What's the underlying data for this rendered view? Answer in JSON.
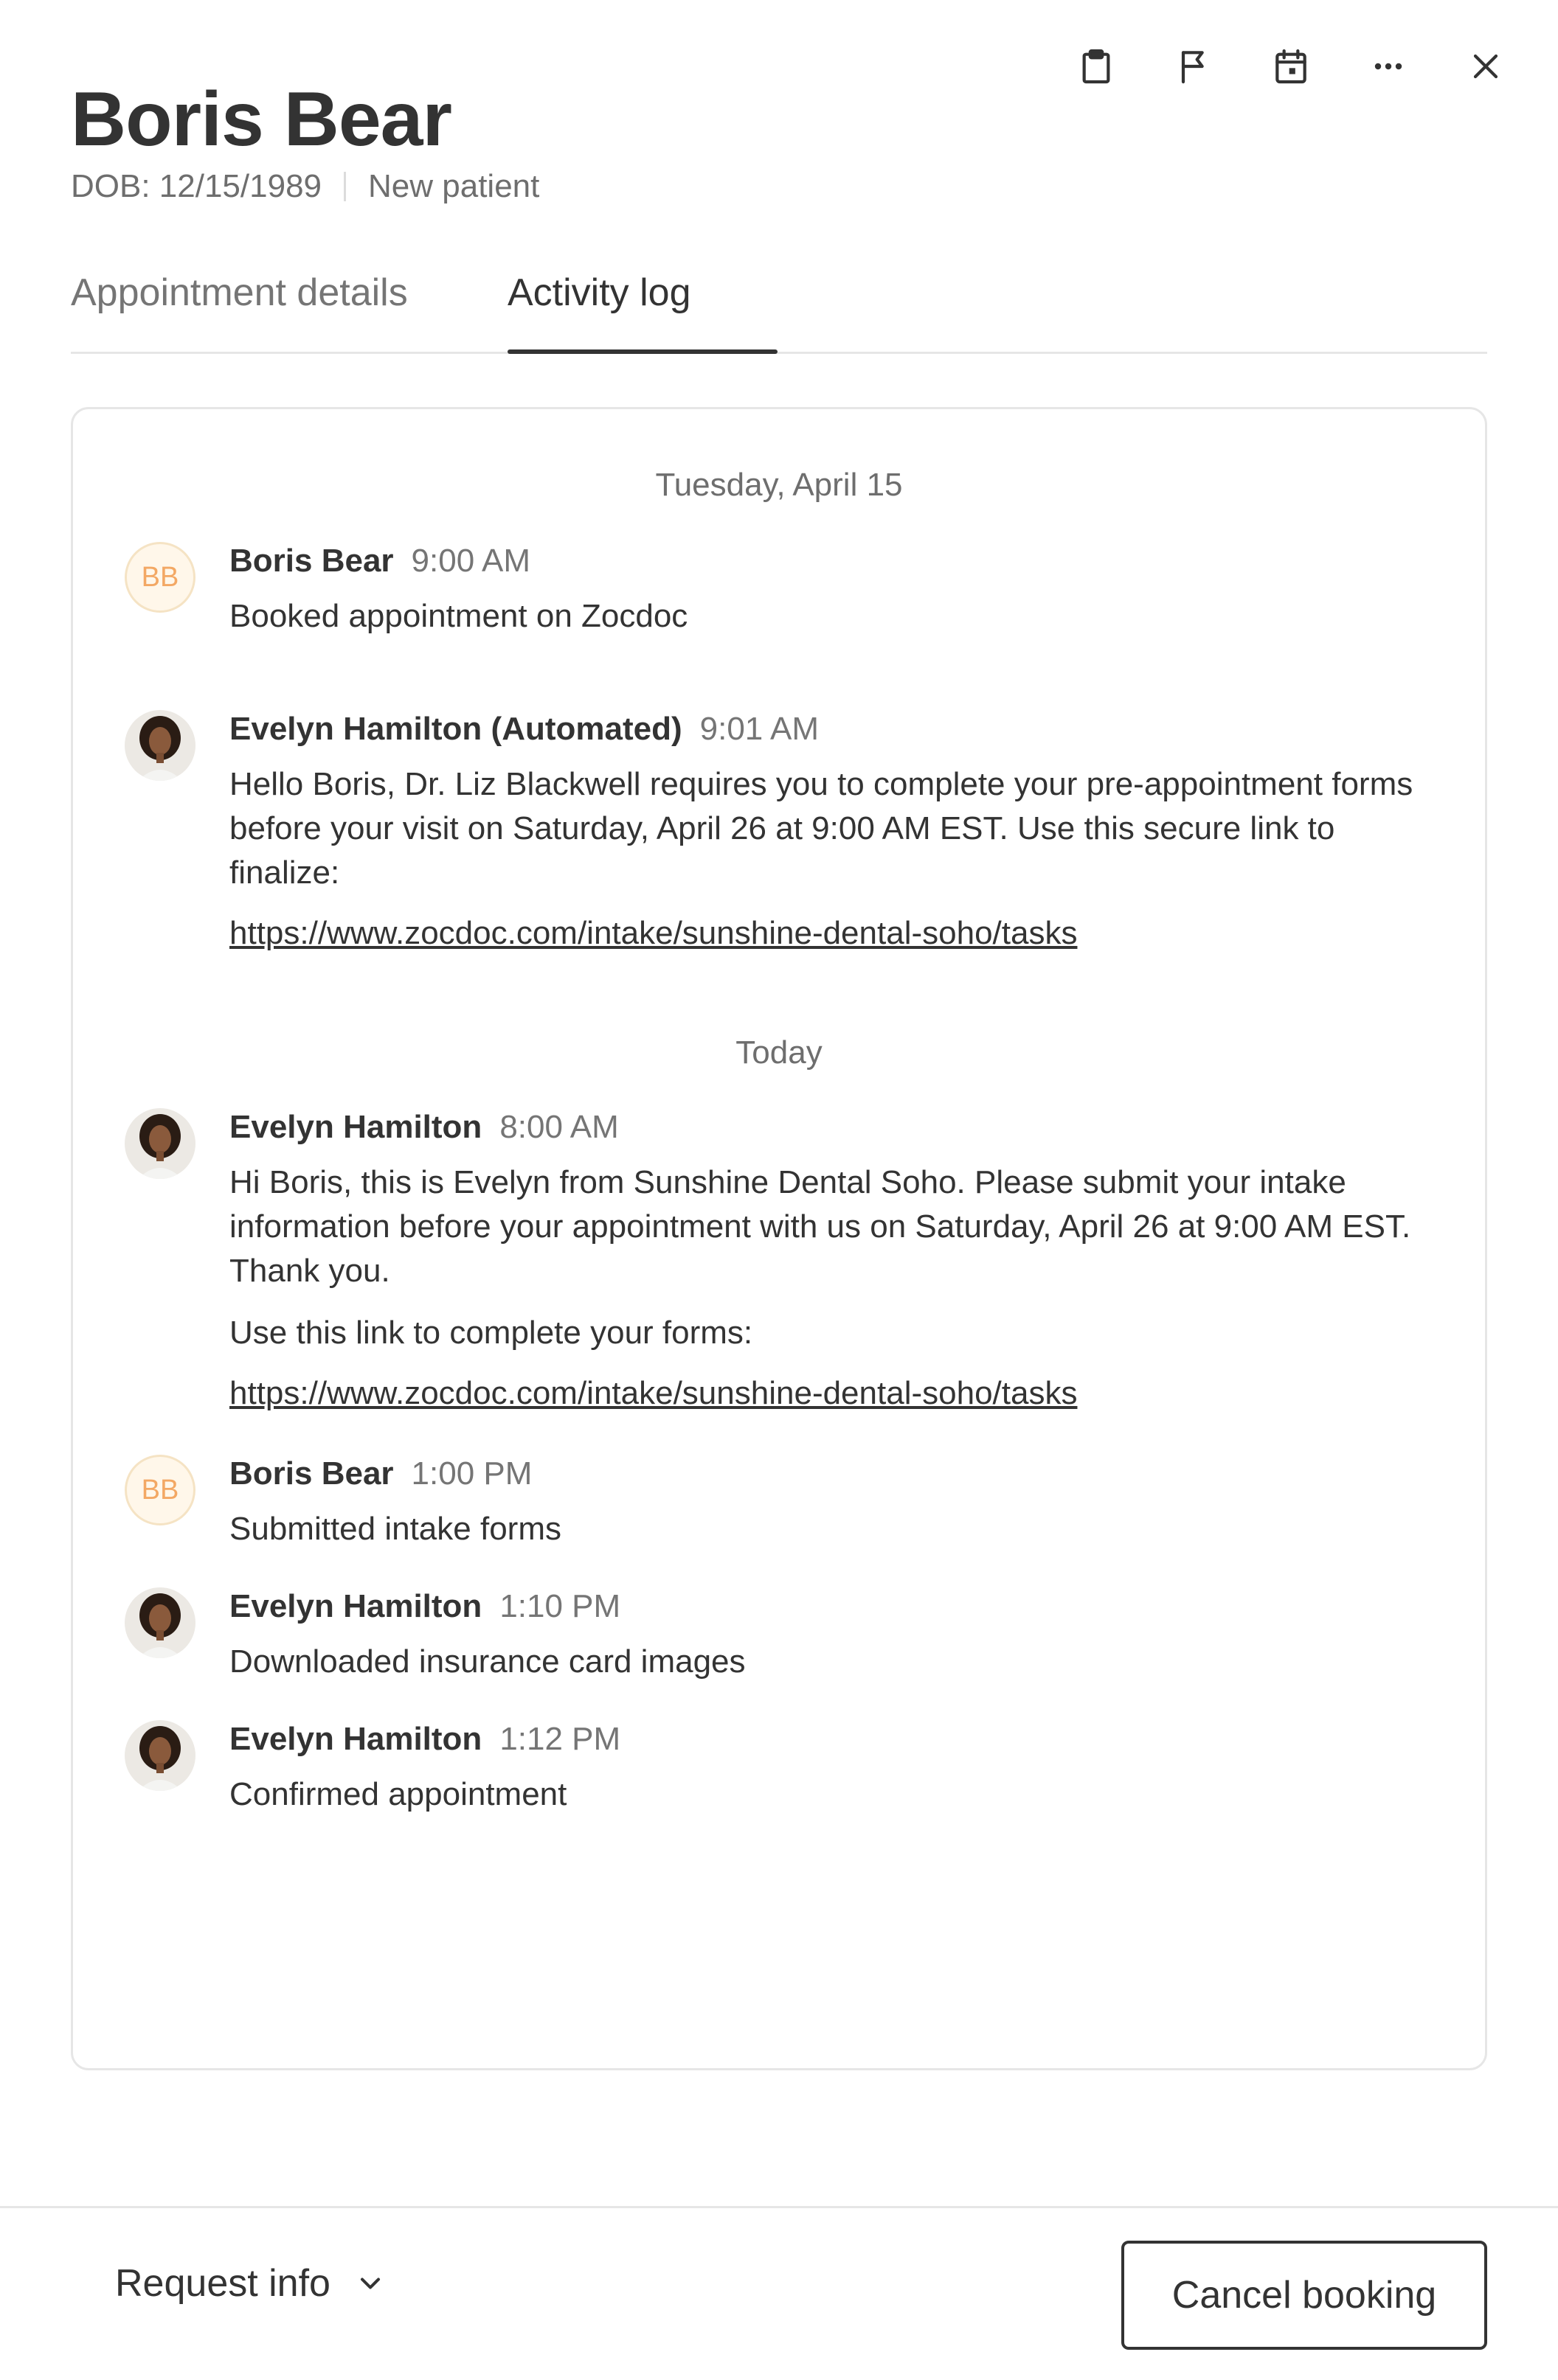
{
  "toolbar": {
    "icons": [
      "clipboard-icon",
      "flag-icon",
      "calendar-icon",
      "more-icon",
      "close-icon"
    ]
  },
  "patient": {
    "name": "Boris Bear",
    "dob": "DOB: 12/15/1989",
    "status": "New patient"
  },
  "tabs": {
    "details": "Appointment details",
    "activity": "Activity log",
    "active": "activity"
  },
  "log": {
    "groups": [
      {
        "date": "Tuesday, April 15",
        "entries": [
          {
            "initials": "BB",
            "author": "Boris Bear",
            "time": "9:00 AM",
            "text": "Booked appointment on Zocdoc"
          },
          {
            "author": "Evelyn Hamilton (Automated)",
            "time": "9:01 AM",
            "text": "Hello Boris, Dr. Liz Blackwell requires you to complete your pre-appointment forms before your visit on Saturday, April 26 at 9:00 AM EST. Use this secure link to finalize:",
            "link": "https://www.zocdoc.com/intake/sunshine-dental-soho/tasks"
          }
        ]
      },
      {
        "date": "Today",
        "entries": [
          {
            "author": "Evelyn Hamilton",
            "time": "8:00 AM",
            "text": "Hi Boris, this is Evelyn from Sunshine Dental Soho. Please submit your intake information before your appointment with us on Saturday, April 26 at 9:00 AM EST. Thank you.",
            "text2": "Use this link to complete your forms:",
            "link": "https://www.zocdoc.com/intake/sunshine-dental-soho/tasks"
          },
          {
            "initials": "BB",
            "author": "Boris Bear",
            "time": "1:00 PM",
            "text": "Submitted intake forms"
          },
          {
            "author": "Evelyn Hamilton",
            "time": "1:10 PM",
            "text": "Downloaded insurance card images"
          },
          {
            "author": "Evelyn Hamilton",
            "time": "1:12 PM",
            "text": "Confirmed appointment"
          }
        ]
      }
    ]
  },
  "footer": {
    "request": "Request info",
    "cancel": "Cancel booking"
  },
  "colors": {
    "text": "#333333",
    "muted": "#757575",
    "border": "#e6e6e6",
    "initials_bg": "#fff7ea",
    "initials_text": "#f3a864"
  }
}
